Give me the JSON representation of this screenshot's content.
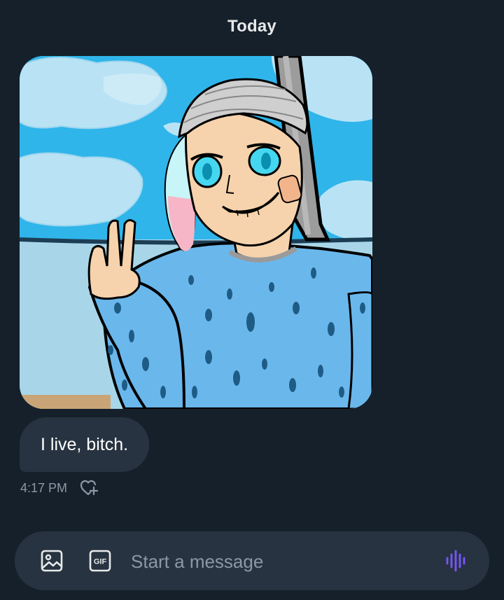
{
  "conversation": {
    "day_divider": "Today"
  },
  "messages": [
    {
      "type": "image",
      "image_alt": "Drawing of a girl with cyan and pink hair, head bandage, blue spotted shirt, making a peace sign"
    },
    {
      "type": "text",
      "text": "I live, bitch.",
      "timestamp": "4:17 PM"
    }
  ],
  "composer": {
    "placeholder": "Start a message",
    "gif_label": "GIF"
  },
  "icons": {
    "media": "image-icon",
    "gif": "gif-icon",
    "voice": "voice-waveform-icon",
    "react": "heart-plus-icon"
  },
  "colors": {
    "background": "#15202b",
    "bubble": "#273340",
    "text_primary": "#e7e9ea",
    "text_secondary": "#8b98a5",
    "accent_purple": "#7856ff"
  }
}
